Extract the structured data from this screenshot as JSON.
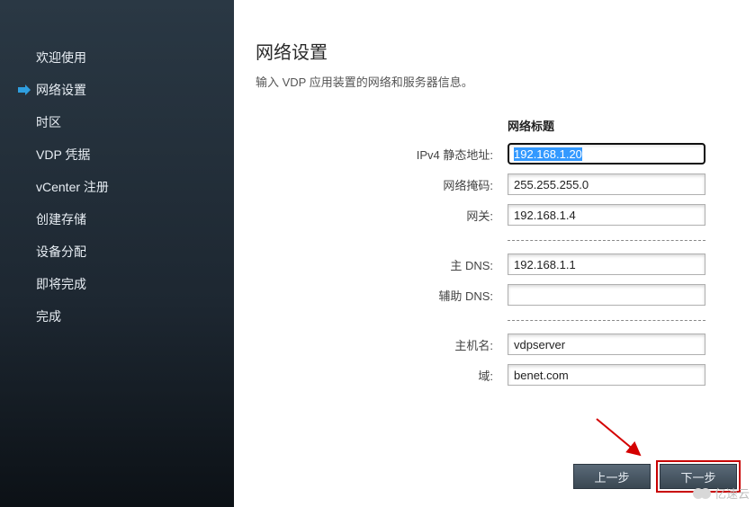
{
  "sidebar": {
    "items": [
      {
        "label": "欢迎使用",
        "active": false
      },
      {
        "label": "网络设置",
        "active": true
      },
      {
        "label": "时区",
        "active": false
      },
      {
        "label": "VDP 凭据",
        "active": false
      },
      {
        "label": "vCenter 注册",
        "active": false
      },
      {
        "label": "创建存储",
        "active": false
      },
      {
        "label": "设备分配",
        "active": false
      },
      {
        "label": "即将完成",
        "active": false
      },
      {
        "label": "完成",
        "active": false
      }
    ]
  },
  "page": {
    "title": "网络设置",
    "description": "输入 VDP 应用装置的网络和服务器信息。"
  },
  "form": {
    "column_header": "网络标题",
    "fields": {
      "ipv4_label": "IPv4 静态地址:",
      "ipv4_value": "192.168.1.20",
      "netmask_label": "网络掩码:",
      "netmask_value": "255.255.255.0",
      "gateway_label": "网关:",
      "gateway_value": "192.168.1.4",
      "primary_dns_label": "主 DNS:",
      "primary_dns_value": "192.168.1.1",
      "secondary_dns_label": "辅助 DNS:",
      "secondary_dns_value": "",
      "hostname_label": "主机名:",
      "hostname_value": "vdpserver",
      "domain_label": "域:",
      "domain_value": "benet.com"
    }
  },
  "buttons": {
    "prev": "上一步",
    "next": "下一步"
  },
  "watermark": {
    "text": "亿速云"
  },
  "annotation": {
    "arrow_color": "#d40000",
    "highlight_color": "#c80000"
  }
}
